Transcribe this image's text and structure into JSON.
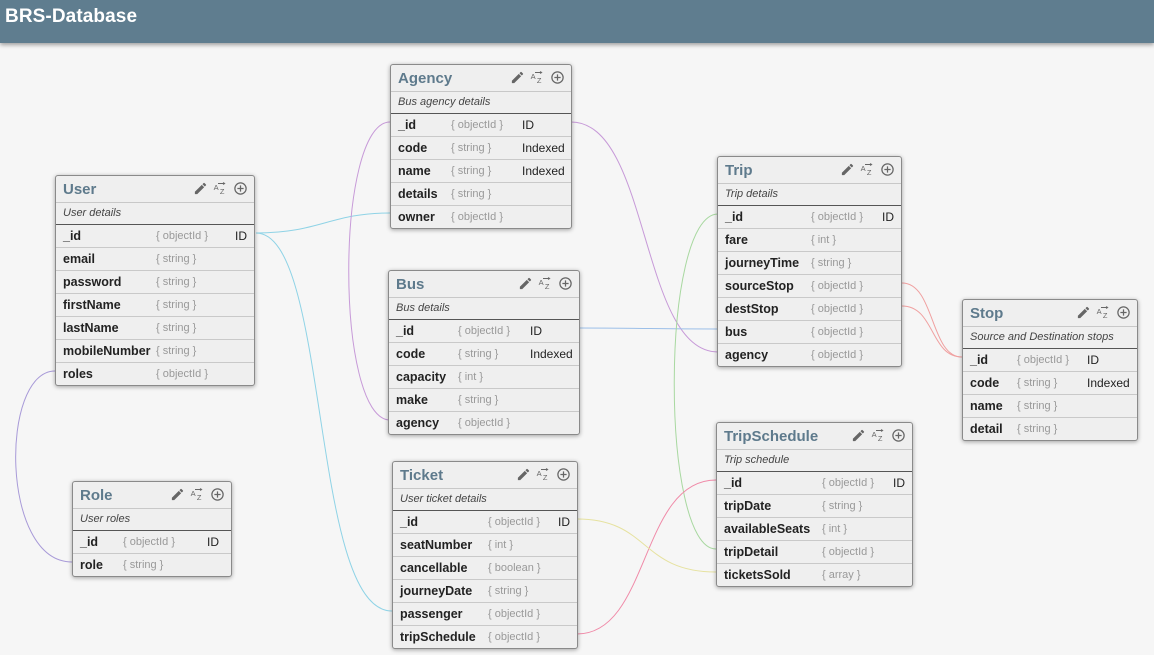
{
  "app": {
    "title": "BRS-Database"
  },
  "colors": {
    "header": "#5f7d8f",
    "table_title": "#5e7a8c",
    "links": {
      "user_agency": "#8fd3e6",
      "user_ticket": "#8fd3e6",
      "role_link": "#a89ad8",
      "agency_bus": "#c79ad8",
      "agency_trip": "#c79ad8",
      "bus_trip": "#9cbfe8",
      "trip_schedule": "#a8d8a0",
      "trip_stop": "#f0a0a0",
      "ticket_schedule": "#f08aa8",
      "ticket_sold": "#e6e2a0"
    }
  },
  "icons": [
    "pencil-icon",
    "sort-az-icon",
    "add-circle-icon"
  ],
  "tables": {
    "user": {
      "name": "User",
      "desc": "User details",
      "fields": [
        {
          "name": "_id",
          "type": "{ objectId }",
          "idx": "ID"
        },
        {
          "name": "email",
          "type": "{ string }",
          "idx": ""
        },
        {
          "name": "password",
          "type": "{ string }",
          "idx": ""
        },
        {
          "name": "firstName",
          "type": "{ string }",
          "idx": ""
        },
        {
          "name": "lastName",
          "type": "{ string }",
          "idx": ""
        },
        {
          "name": "mobileNumber",
          "type": "{ string }",
          "idx": ""
        },
        {
          "name": "roles",
          "type": "{ objectId }",
          "idx": ""
        }
      ]
    },
    "role": {
      "name": "Role",
      "desc": "User roles",
      "fields": [
        {
          "name": "_id",
          "type": "{ objectId }",
          "idx": "ID"
        },
        {
          "name": "role",
          "type": "{ string }",
          "idx": ""
        }
      ]
    },
    "agency": {
      "name": "Agency",
      "desc": "Bus agency details",
      "fields": [
        {
          "name": "_id",
          "type": "{ objectId }",
          "idx": "ID"
        },
        {
          "name": "code",
          "type": "{ string }",
          "idx": "Indexed"
        },
        {
          "name": "name",
          "type": "{ string }",
          "idx": "Indexed"
        },
        {
          "name": "details",
          "type": "{ string }",
          "idx": ""
        },
        {
          "name": "owner",
          "type": "{ objectId }",
          "idx": ""
        }
      ]
    },
    "bus": {
      "name": "Bus",
      "desc": "Bus details",
      "fields": [
        {
          "name": "_id",
          "type": "{ objectId }",
          "idx": "ID"
        },
        {
          "name": "code",
          "type": "{ string }",
          "idx": "Indexed"
        },
        {
          "name": "capacity",
          "type": "{ int }",
          "idx": ""
        },
        {
          "name": "make",
          "type": "{ string }",
          "idx": ""
        },
        {
          "name": "agency",
          "type": "{ objectId }",
          "idx": ""
        }
      ]
    },
    "ticket": {
      "name": "Ticket",
      "desc": "User ticket details",
      "fields": [
        {
          "name": "_id",
          "type": "{ objectId }",
          "idx": "ID"
        },
        {
          "name": "seatNumber",
          "type": "{ int }",
          "idx": ""
        },
        {
          "name": "cancellable",
          "type": "{ boolean }",
          "idx": ""
        },
        {
          "name": "journeyDate",
          "type": "{ string }",
          "idx": ""
        },
        {
          "name": "passenger",
          "type": "{ objectId }",
          "idx": ""
        },
        {
          "name": "tripSchedule",
          "type": "{ objectId }",
          "idx": ""
        }
      ]
    },
    "trip": {
      "name": "Trip",
      "desc": "Trip details",
      "fields": [
        {
          "name": "_id",
          "type": "{ objectId }",
          "idx": "ID"
        },
        {
          "name": "fare",
          "type": "{ int }",
          "idx": ""
        },
        {
          "name": "journeyTime",
          "type": "{ string }",
          "idx": ""
        },
        {
          "name": "sourceStop",
          "type": "{ objectId }",
          "idx": ""
        },
        {
          "name": "destStop",
          "type": "{ objectId }",
          "idx": ""
        },
        {
          "name": "bus",
          "type": "{ objectId }",
          "idx": ""
        },
        {
          "name": "agency",
          "type": "{ objectId }",
          "idx": ""
        }
      ]
    },
    "tripschedule": {
      "name": "TripSchedule",
      "desc": "Trip schedule",
      "fields": [
        {
          "name": "_id",
          "type": "{ objectId }",
          "idx": "ID"
        },
        {
          "name": "tripDate",
          "type": "{ string }",
          "idx": ""
        },
        {
          "name": "availableSeats",
          "type": "{ int }",
          "idx": ""
        },
        {
          "name": "tripDetail",
          "type": "{ objectId }",
          "idx": ""
        },
        {
          "name": "ticketsSold",
          "type": "{ array }",
          "idx": ""
        }
      ]
    },
    "stop": {
      "name": "Stop",
      "desc": "Source and Destination stops",
      "fields": [
        {
          "name": "_id",
          "type": "{ objectId }",
          "idx": "ID"
        },
        {
          "name": "code",
          "type": "{ string }",
          "idx": "Indexed"
        },
        {
          "name": "name",
          "type": "{ string }",
          "idx": ""
        },
        {
          "name": "detail",
          "type": "{ string }",
          "idx": ""
        }
      ]
    }
  }
}
